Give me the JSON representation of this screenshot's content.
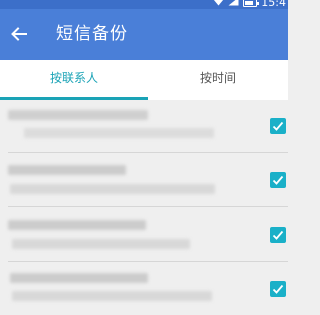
{
  "status_bar": {
    "time": "15:4"
  },
  "app_bar": {
    "title": "短信备份"
  },
  "tabs": [
    {
      "label": "按联系人",
      "selected": true
    },
    {
      "label": "按时间",
      "selected": false
    }
  ],
  "list": {
    "items": [
      {
        "checked": true
      },
      {
        "checked": true
      },
      {
        "checked": true
      },
      {
        "checked": true
      }
    ]
  },
  "colors": {
    "accent": "#1aa3b6",
    "appbar": "#4a7fd8",
    "checkbox": "#1ab0c8"
  }
}
